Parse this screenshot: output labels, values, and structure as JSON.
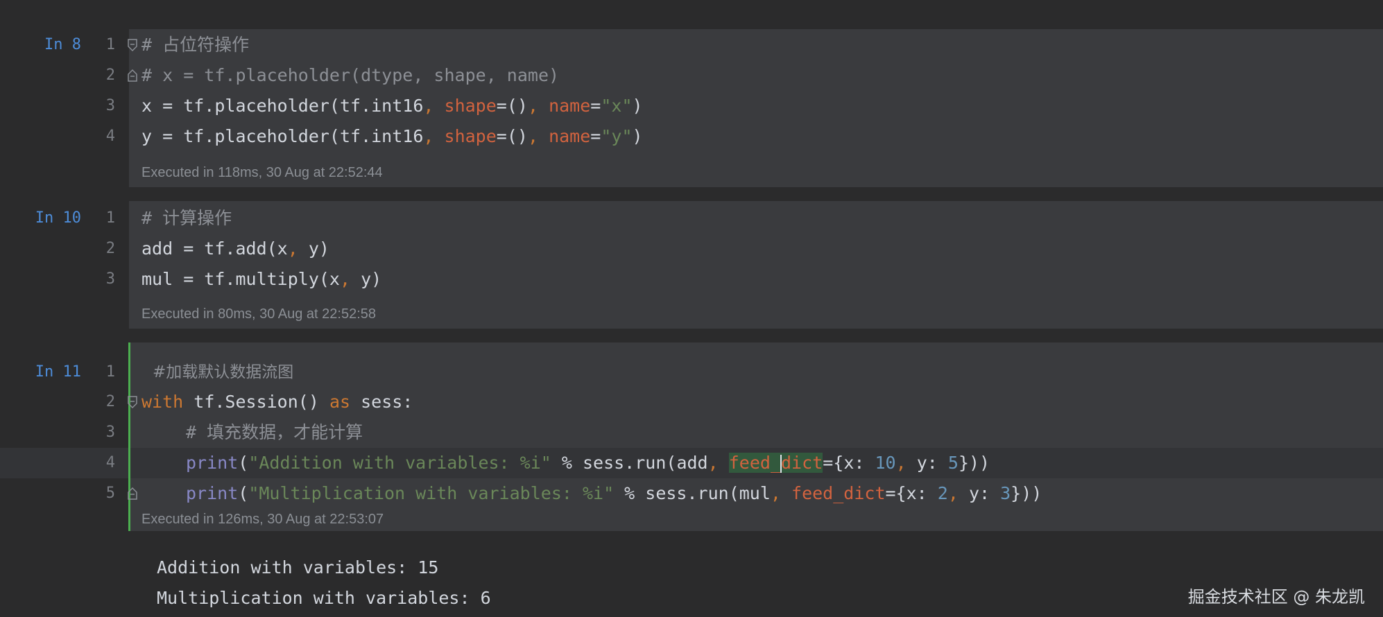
{
  "cells": [
    {
      "label": "In 8",
      "exec": "Executed in 118ms, 30 Aug at 22:52:44",
      "lines": [
        {
          "n": "1",
          "c0": "# 占位符操作"
        },
        {
          "n": "2",
          "c0": "# x = tf.placeholder(dtype, shape, name)"
        },
        {
          "n": "3",
          "c0": "x = tf.placeholder(tf.int16",
          ",": ",",
          "k1": "shape",
          "e1": "=()",
          "k2": "name",
          "s": "\"x\"",
          "p": ")"
        },
        {
          "n": "4",
          "c0": "y = tf.placeholder(tf.int16",
          ",": ",",
          "k1": "shape",
          "e1": "=()",
          "k2": "name",
          "s": "\"y\"",
          "p": ")"
        }
      ]
    },
    {
      "label": "In 10",
      "exec": "Executed in 80ms, 30 Aug at 22:52:58",
      "lines": [
        {
          "n": "1",
          "c0": "# 计算操作"
        },
        {
          "n": "2",
          "c0": "add = tf.add(x",
          ",": ",",
          "c1": " y)"
        },
        {
          "n": "3",
          "c0": "mul = tf.multiply(x",
          ",": ",",
          "c1": " y)"
        }
      ]
    },
    {
      "label": "In 11",
      "exec": "Executed in 126ms, 30 Aug at 22:53:07",
      "lines": [
        {
          "n": "1",
          "c0": "#加载默认数据流图"
        },
        {
          "n": "2",
          "kw1": "with",
          "c1": " tf.Session() ",
          "kw2": "as",
          "c2": " sess:"
        },
        {
          "n": "3",
          "c0": "# 填充数据，才能计算"
        },
        {
          "n": "4",
          "b": "print",
          "s": "\"Addition with variables: %i\"",
          "c1": " % sess.run(add",
          ",": ",",
          "fk1": "feed_",
          "fk2": "dict",
          "c2": "={x: ",
          "n1": "10",
          "sep": ",",
          "c3": " y: ",
          "n2": "5",
          "c4": "}))"
        },
        {
          "n": "5",
          "b": "print",
          "s": "\"Multiplication with variables: %i\"",
          "c1": " % sess.run(mul",
          ",": ",",
          "fk": "feed_dict",
          "c2": "={x: ",
          "n1": "2",
          "sep": ",",
          "c3": " y: ",
          "n2": "3",
          "c4": "}))"
        }
      ]
    }
  ],
  "output": [
    "Addition with variables: 15",
    "Multiplication with variables: 6"
  ],
  "watermark": "掘金技术社区 @ 朱龙凯",
  "colors": {
    "keyword": "#cc7832",
    "string": "#6a8759",
    "number": "#6897bb",
    "kwarg": "#d2633f",
    "label": "#4d8cd8",
    "active": "#4caf50"
  }
}
